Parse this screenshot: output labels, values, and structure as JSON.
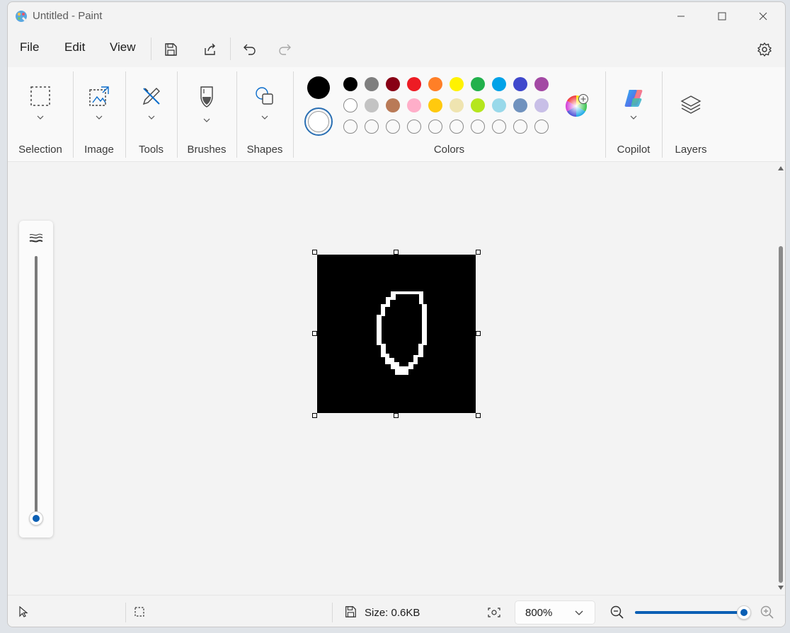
{
  "window": {
    "title": "Untitled - Paint"
  },
  "menu": {
    "file": "File",
    "edit": "Edit",
    "view": "View"
  },
  "ribbon": {
    "selection": "Selection",
    "image": "Image",
    "tools": "Tools",
    "brushes": "Brushes",
    "shapes": "Shapes",
    "colors": "Colors",
    "copilot": "Copilot",
    "layers": "Layers"
  },
  "colors": {
    "primary": "#000000",
    "secondary": "#ffffff",
    "row1": [
      "#000000",
      "#7f7f7f",
      "#880015",
      "#ed1c24",
      "#ff7f27",
      "#fff200",
      "#22b14c",
      "#00a2e8",
      "#3f48cc",
      "#a349a4"
    ],
    "row2": [
      "#ffffff",
      "#c3c3c3",
      "#b97a57",
      "#ffaec9",
      "#ffc90e",
      "#efe4b0",
      "#b5e61d",
      "#99d9ea",
      "#7092be",
      "#c8bfe7"
    ],
    "row3_count": 10
  },
  "status": {
    "size": "Size: 0.6KB",
    "zoom": "800%"
  },
  "zoom_slider": {
    "fraction": 0.95
  },
  "brush_size_slider": {
    "fraction": 0.0
  }
}
